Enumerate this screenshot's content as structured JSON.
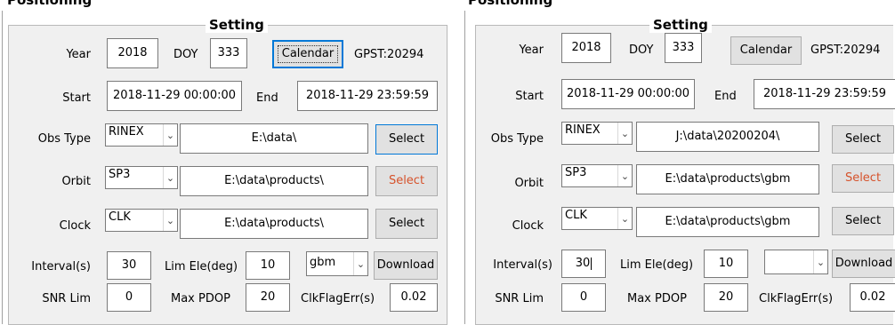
{
  "panels": [
    {
      "section_title": "Positioning",
      "group_title": "Setting",
      "labels": {
        "year": "Year",
        "doy": "DOY",
        "start": "Start",
        "end": "End",
        "obs_type": "Obs Type",
        "orbit": "Orbit",
        "clock": "Clock",
        "interval": "Interval(s)",
        "lim_ele": "Lim Ele(deg)",
        "snr_lim": "SNR Lim",
        "max_pdop": "Max PDOP",
        "clk_flag": "ClkFlagErr(s)"
      },
      "gpst": "GPST:20294",
      "fields": {
        "year": "2018",
        "doy": "333",
        "start": "2018-11-29 00:00:00",
        "end": "2018-11-29 23:59:59",
        "obs_path": "E:\\data\\",
        "orbit_path": "E:\\data\\products\\",
        "clock_path": "E:\\data\\products\\",
        "interval": "30",
        "lim_ele": "10",
        "snr_lim": "0",
        "max_pdop": "20",
        "clk_flag": "0.02"
      },
      "combos": {
        "obs_type": "RINEX",
        "orbit": "SP3",
        "clock": "CLK",
        "product": "gbm"
      },
      "buttons": {
        "calendar": "Calendar",
        "obs_select": "Select",
        "orbit_select": "Select",
        "clock_select": "Select",
        "download": "Download"
      }
    },
    {
      "section_title": "Positioning",
      "group_title": "Setting",
      "labels": {
        "year": "Year",
        "doy": "DOY",
        "start": "Start",
        "end": "End",
        "obs_type": "Obs Type",
        "orbit": "Orbit",
        "clock": "Clock",
        "interval": "Interval(s)",
        "lim_ele": "Lim Ele(deg)",
        "snr_lim": "SNR Lim",
        "max_pdop": "Max PDOP",
        "clk_flag": "ClkFlagErr(s)"
      },
      "gpst": "GPST:20294",
      "fields": {
        "year": "2018",
        "doy": "333",
        "start": "2018-11-29 00:00:00",
        "end": "2018-11-29 23:59:59",
        "obs_path": "J:\\data\\20200204\\",
        "orbit_path": "E:\\data\\products\\gbm",
        "clock_path": "E:\\data\\products\\gbm",
        "interval": "30",
        "lim_ele": "10",
        "snr_lim": "0",
        "max_pdop": "20",
        "clk_flag": "0.02"
      },
      "combos": {
        "obs_type": "RINEX",
        "orbit": "SP3",
        "clock": "CLK",
        "product": ""
      },
      "buttons": {
        "calendar": "Calendar",
        "obs_select": "Select",
        "orbit_select": "Select",
        "clock_select": "Select",
        "download": "Download"
      }
    }
  ],
  "colors": {
    "disabled_select_text": "#d6522b",
    "focus_border": "#0078d7",
    "group_bg": "#f0f0f0"
  },
  "icons": {
    "combo_arrow": "chevron-down-icon"
  }
}
